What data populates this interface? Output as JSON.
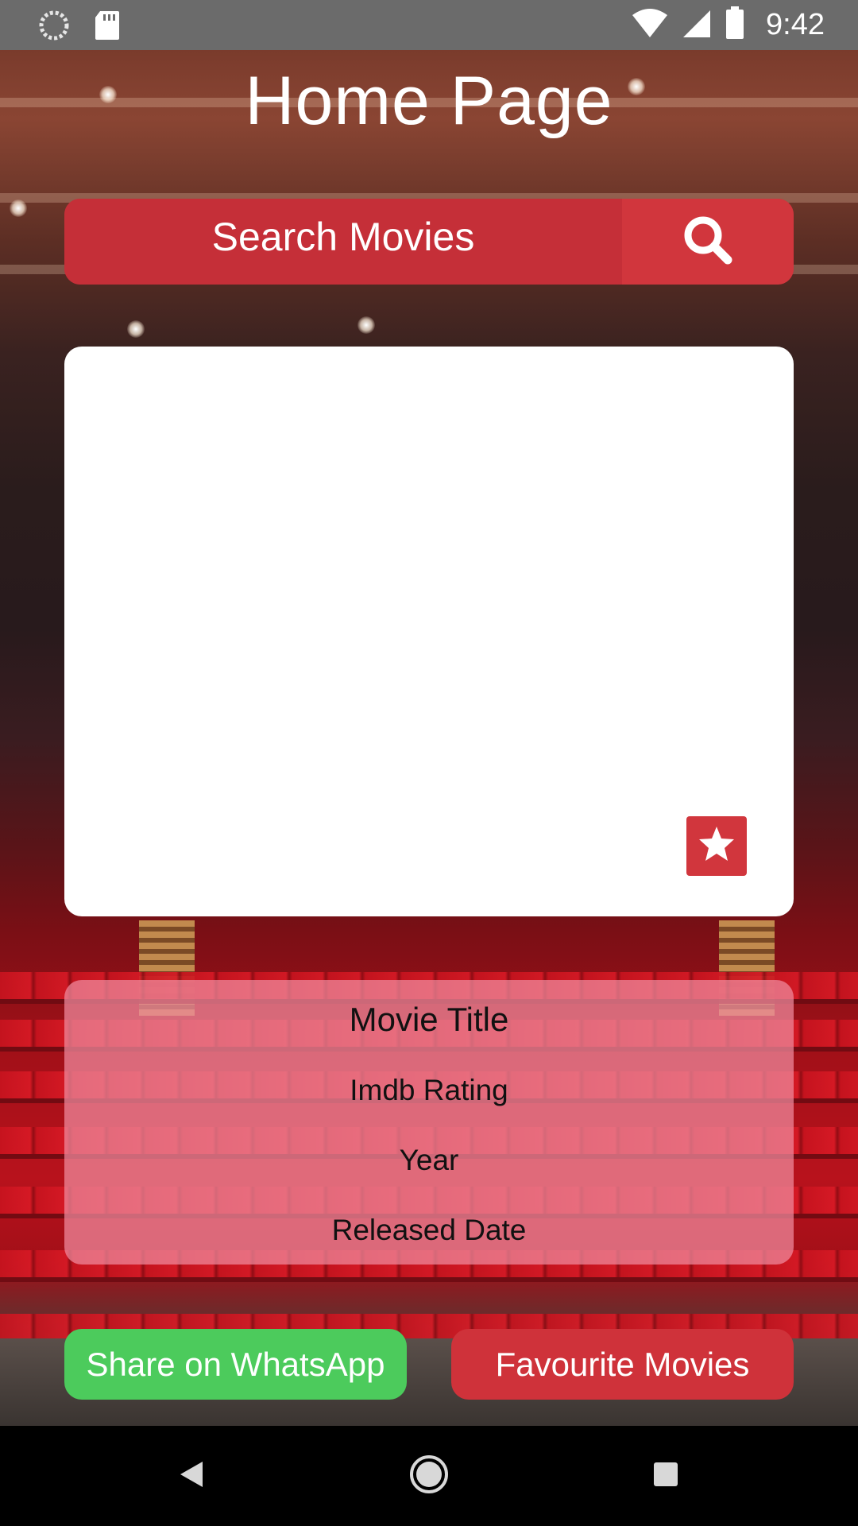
{
  "status_bar": {
    "time": "9:42",
    "icons": [
      "sync-icon",
      "sd-card-icon",
      "wifi-icon",
      "signal-icon",
      "battery-icon"
    ]
  },
  "header": {
    "title": "Home Page"
  },
  "search": {
    "placeholder": "Search Movies",
    "button_icon": "search-icon"
  },
  "poster": {
    "favourite_icon": "star-icon"
  },
  "movie_info": {
    "title": "Movie Title",
    "rating": "Imdb Rating",
    "year": "Year",
    "released": "Released Date"
  },
  "actions": {
    "share_label": "Share on WhatsApp",
    "favourites_label": "Favourite Movies"
  },
  "colors": {
    "accent_red": "#d1363d",
    "whatsapp_green": "#4ccb5c",
    "info_panel_pink": "#f08ca0"
  },
  "nav": {
    "icons": [
      "back-icon",
      "home-icon",
      "recents-icon"
    ]
  }
}
